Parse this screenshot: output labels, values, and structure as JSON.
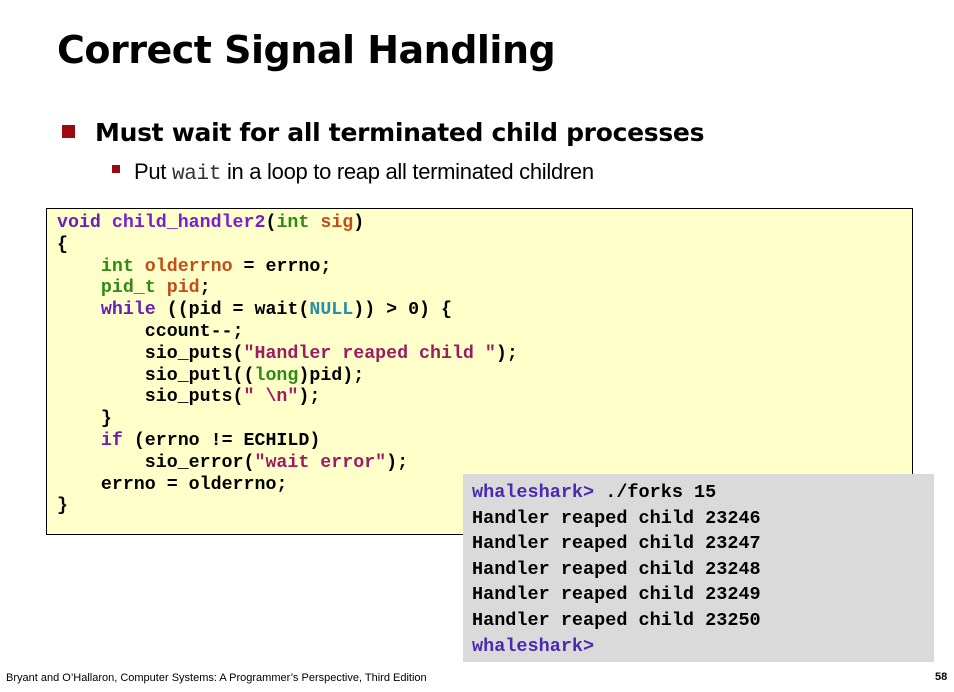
{
  "slide": {
    "title": "Correct Signal Handling",
    "bullet1": "Must wait for all terminated child processes",
    "bullet2_pre": "Put ",
    "bullet2_code": "wait",
    "bullet2_post": " in a loop to reap all terminated children"
  },
  "code": {
    "l0_kw": "void",
    "l0_fn": "child_handler2",
    "l0_p1": "(",
    "l0_ty": "int",
    "l0_vr": "sig",
    "l0_p2": ")",
    "l1": "{",
    "l2_ty": "int",
    "l2_vr": "olderrno",
    "l2_rest": " = errno;",
    "l3_ty": "pid_t",
    "l3_vr": "pid",
    "l3_rest": ";",
    "l4_kw": "while",
    "l4_a": " ((pid = wait(",
    "l4_cn": "NULL",
    "l4_b": ")) > 0) {",
    "l5": "ccount--;",
    "l6_a": "sio_puts(",
    "l6_st": "\"Handler reaped child \"",
    "l6_b": ");",
    "l7_a": "sio_putl((",
    "l7_ty": "long",
    "l7_b": ")pid);",
    "l8_a": "sio_puts(",
    "l8_st": "\" \\n\"",
    "l8_b": ");",
    "l9": "}",
    "l10_kw": "if",
    "l10_rest": " (errno != ECHILD)",
    "l11_a": "sio_error(",
    "l11_st": "\"wait error\"",
    "l11_b": ");",
    "l12": "errno = olderrno;",
    "l13": "}"
  },
  "terminal": {
    "prompt1": "whaleshark>",
    "cmd": " ./forks 15",
    "lines": [
      "Handler reaped child 23246",
      "Handler reaped child 23247",
      "Handler reaped child 23248",
      "Handler reaped child 23249",
      "Handler reaped child 23250"
    ],
    "prompt2": "whaleshark>"
  },
  "footer": {
    "credit": "Bryant and O’Hallaron, Computer Systems: A Programmer’s Perspective, Third Edition",
    "page": "58"
  },
  "colors": {
    "bullet": "#9b0a0f",
    "code_bg": "#ffffc9",
    "terminal_bg": "#dadada",
    "keyword": "#6a1fb8",
    "type": "#2f8a17",
    "string": "#9c1c62",
    "prompt": "#4a2ab0"
  }
}
